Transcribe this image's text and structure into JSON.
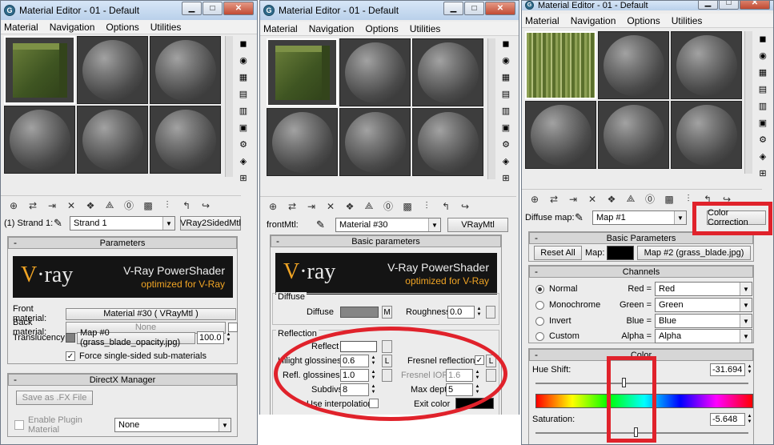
{
  "windows": [
    {
      "title": "Material Editor - 01 - Default",
      "menu": [
        "Material",
        "Navigation",
        "Options",
        "Utilities"
      ],
      "slot_name": "(1) Strand 1:",
      "material_name": "Strand 1",
      "material_type": "VRay2SidedMtl",
      "params_title": "Parameters",
      "vray_title": "V-Ray PowerShader",
      "vray_sub": "optimized for V-Ray",
      "front_label": "Front material:",
      "front_value": "Material #30  ( VRayMtl )",
      "back_label": "Back material:",
      "back_value": "None",
      "transl_label": "Translucency:",
      "transl_map": "Map #0 (grass_blade_opacity.jpg)",
      "transl_amount": "100.0",
      "force_label": "Force single-sided sub-materials",
      "dx_title": "DirectX Manager",
      "save_fx": "Save as .FX File",
      "plugin_label": "Enable Plugin Material",
      "plugin_value": "None"
    },
    {
      "title": "Material Editor - 01 - Default",
      "menu": [
        "Material",
        "Navigation",
        "Options",
        "Utilities"
      ],
      "slot_name": "frontMtl:",
      "material_name": "Material #30",
      "material_type": "VRayMtl",
      "params_title": "Basic parameters",
      "vray_title": "V-Ray PowerShader",
      "vray_sub": "optimized for V-Ray",
      "diffuse_group": "Diffuse",
      "diffuse_label": "Diffuse",
      "diffuse_m": "M",
      "roughness_label": "Roughness",
      "roughness_value": "0.0",
      "reflection_group": "Reflection",
      "reflect_label": "Reflect",
      "hilight_label": "Hilight glossiness",
      "hilight_value": "0.6",
      "l_label": "L",
      "fresnel_label": "Fresnel reflections",
      "refl_gloss_label": "Refl. glossiness",
      "refl_gloss_value": "1.0",
      "fresnel_ior_label": "Fresnel IOR",
      "fresnel_ior_value": "1.6",
      "subdivs_label": "Subdivs",
      "subdivs_value": "8",
      "max_depth_label": "Max depth",
      "max_depth_value": "5",
      "use_interp_label": "Use interpolation",
      "exit_color_label": "Exit color"
    },
    {
      "title": "Material Editor - 01 - Default",
      "menu": [
        "Material",
        "Navigation",
        "Options",
        "Utilities"
      ],
      "slot_name": "Diffuse map:",
      "material_name": "Map #1",
      "material_type": "Color Correction",
      "basic_title": "Basic Parameters",
      "reset_all": "Reset All",
      "map_label": "Map:",
      "map_value": "Map #2 (grass_blade.jpg)",
      "channels_title": "Channels",
      "channels": [
        {
          "mode": "Normal",
          "chan": "Red =",
          "value": "Red"
        },
        {
          "mode": "Monochrome",
          "chan": "Green =",
          "value": "Green"
        },
        {
          "mode": "Invert",
          "chan": "Blue =",
          "value": "Blue"
        },
        {
          "mode": "Custom",
          "chan": "Alpha =",
          "value": "Alpha"
        }
      ],
      "color_title": "Color",
      "hue_label": "Hue Shift:",
      "hue_value": "-31.694",
      "sat_label": "Saturation:",
      "sat_value": "-5.648"
    }
  ],
  "colors": {
    "highlight": "#e0222b",
    "vray_orange": "#f0a424"
  }
}
